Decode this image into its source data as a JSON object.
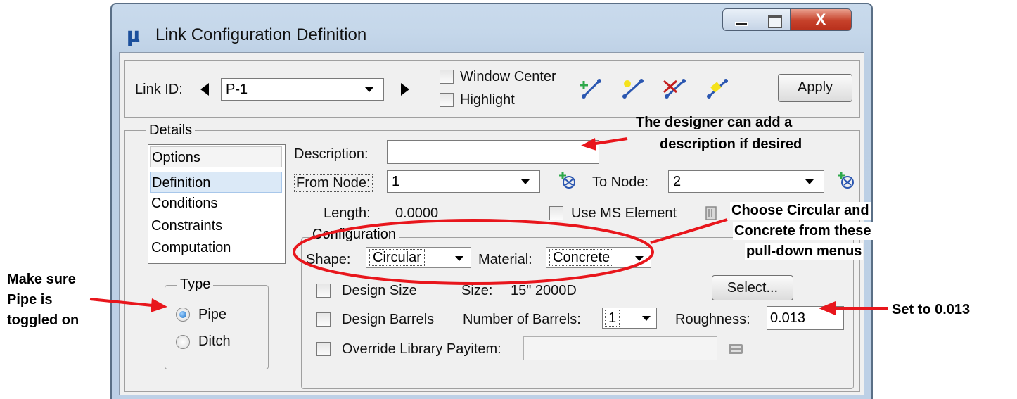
{
  "window": {
    "title": "Link Configuration Definition",
    "icon": "app-logo-icon",
    "close_glyph": "X"
  },
  "toolbar": {
    "link_id_label": "Link ID:",
    "link_id_value": "P-1",
    "window_center_label": "Window Center",
    "highlight_label": "Highlight",
    "apply_label": "Apply",
    "tool_icons": [
      "add-link-icon",
      "edit-link-icon",
      "delete-link-icon",
      "link-tool-icon"
    ]
  },
  "details": {
    "group_label": "Details",
    "list_header": "Options",
    "list_items": [
      "Definition",
      "Conditions",
      "Constraints",
      "Computation"
    ],
    "selected_item": "Definition",
    "description_label": "Description:",
    "description_value": "",
    "from_node_label": "From Node:",
    "from_node_value": "1",
    "to_node_label": "To Node:",
    "to_node_value": "2",
    "length_label": "Length:",
    "length_value": "0.0000",
    "use_ms_element_label": "Use MS Element"
  },
  "type": {
    "group_label": "Type",
    "pipe_label": "Pipe",
    "ditch_label": "Ditch",
    "selected": "Pipe"
  },
  "configuration": {
    "group_label": "Configuration",
    "shape_label": "Shape:",
    "shape_value": "Circular",
    "material_label": "Material:",
    "material_value": "Concrete",
    "design_size_label": "Design Size",
    "size_label": "Size:",
    "size_value": "15\" 2000D",
    "select_label": "Select...",
    "design_barrels_label": "Design Barrels",
    "barrels_label": "Number of Barrels:",
    "barrels_value": "1",
    "roughness_label": "Roughness:",
    "roughness_value": "0.013",
    "override_label": "Override Library Payitem:",
    "override_value": ""
  },
  "annotations": {
    "description_note_1": "The designer can add a",
    "description_note_2": "description if desired",
    "choose_note_1": "Choose Circular and",
    "choose_note_2": "Concrete from these",
    "choose_note_3": "pull-down menus",
    "pipe_note_1": "Make sure",
    "pipe_note_2": "Pipe is",
    "pipe_note_3": "toggled on",
    "roughness_note": "Set to 0.013",
    "arrow_color": "#e8161c"
  },
  "colors": {
    "title_bar": "#c5d7ea",
    "close_button": "#c6412a",
    "selection": "#dbe9f7",
    "annotation_red": "#e8161c"
  }
}
